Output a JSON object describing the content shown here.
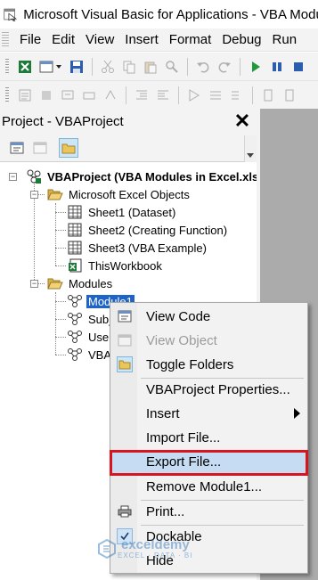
{
  "window": {
    "title": "Microsoft Visual Basic for Applications - VBA Modules in Excel.xlsm"
  },
  "menu": [
    "File",
    "Edit",
    "View",
    "Insert",
    "Format",
    "Debug",
    "Run"
  ],
  "project_panel": {
    "title": "Project - VBAProject",
    "close_glyph": "✕",
    "tree": {
      "root": "VBAProject (VBA Modules in Excel.xlsm)",
      "excel_objects_folder": "Microsoft Excel Objects",
      "sheets": [
        "Sheet1 (Dataset)",
        "Sheet2 (Creating Function)",
        "Sheet3 (VBA Example)",
        "ThisWorkbook"
      ],
      "modules_folder": "Modules",
      "modules": [
        "Module1",
        "Sub_",
        "User",
        "VBA"
      ]
    }
  },
  "context_menu": {
    "items": [
      {
        "label": "View Code",
        "icon": "view-code-icon",
        "enabled": true
      },
      {
        "label": "View Object",
        "icon": "view-object-icon",
        "enabled": false
      },
      {
        "label": "Toggle Folders",
        "icon": "folder-icon",
        "enabled": true
      },
      {
        "label": "VBAProject Properties...",
        "enabled": true
      },
      {
        "label": "Insert",
        "enabled": true,
        "submenu": true
      },
      {
        "label": "Import File...",
        "enabled": true
      },
      {
        "label": "Export File...",
        "enabled": true,
        "highlighted": true
      },
      {
        "label": "Remove Module1...",
        "enabled": true
      },
      {
        "label": "Print...",
        "icon": "printer-icon",
        "enabled": true
      },
      {
        "label": "Dockable",
        "icon": "checkmark-icon",
        "enabled": true,
        "checked": true
      },
      {
        "label": "Hide",
        "enabled": true
      }
    ]
  },
  "watermark": {
    "name": "exceldemy",
    "tagline": "EXCEL · DATA · BI"
  },
  "colors": {
    "selection": "#1e63c6",
    "highlight_box": "#d8151f",
    "menu_hover": "#c5dcf2"
  }
}
